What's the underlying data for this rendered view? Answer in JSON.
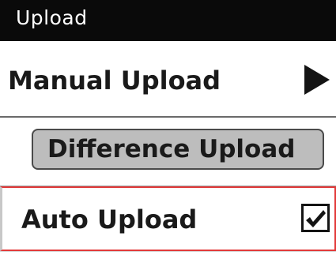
{
  "header": {
    "title": "Upload"
  },
  "menu": {
    "manual_upload": {
      "label": "Manual Upload",
      "icon": "arrow-right-icon"
    },
    "difference_upload": {
      "label": "Difference Upload"
    },
    "auto_upload": {
      "label": "Auto Upload",
      "checked": true,
      "icon": "checkmark-icon"
    }
  },
  "colors": {
    "header_bg": "#0a0a0a",
    "header_text": "#ffffff",
    "button_bg": "#bdbdbd",
    "focus_border": "#e23a3a"
  }
}
